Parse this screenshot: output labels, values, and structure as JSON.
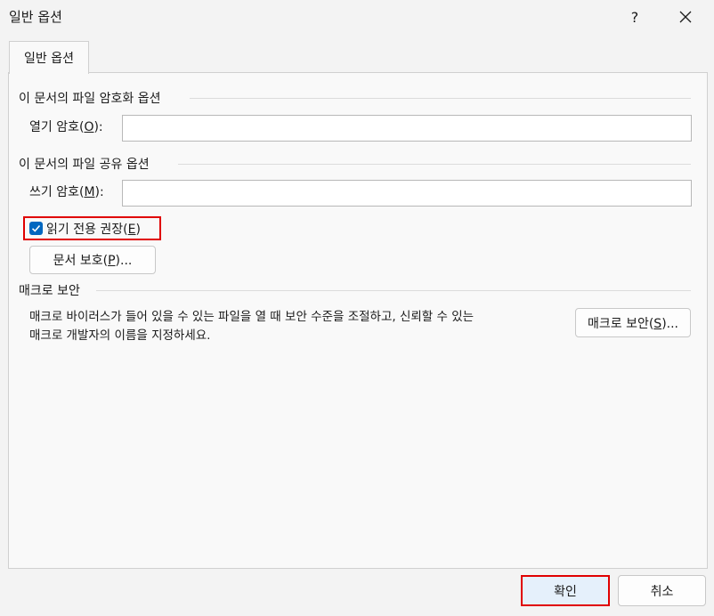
{
  "window": {
    "title": "일반 옵션",
    "help_label": "?"
  },
  "tab": {
    "label": "일반 옵션"
  },
  "encryption": {
    "section_title": "이 문서의 파일 암호화 옵션",
    "open_password_label_prefix": "열기 암호(",
    "open_password_accel": "O",
    "open_password_label_suffix": "):",
    "open_password_value": ""
  },
  "sharing": {
    "section_title": "이 문서의 파일 공유 옵션",
    "modify_password_label_prefix": "쓰기 암호(",
    "modify_password_accel": "M",
    "modify_password_label_suffix": "):",
    "modify_password_value": "",
    "read_only_checked": true,
    "read_only_label_prefix": "읽기 전용 권장(",
    "read_only_accel": "E",
    "read_only_label_suffix": ")",
    "protect_button_prefix": "문서 보호(",
    "protect_button_accel": "P",
    "protect_button_suffix": ")..."
  },
  "macro": {
    "section_title": "매크로 보안",
    "description_line1": "매크로 바이러스가 들어 있을 수 있는 파일을 열 때 보안 수준을 조절하고, 신뢰할 수 있는",
    "description_line2": "매크로 개발자의 이름을 지정하세요.",
    "button_prefix": "매크로 보안(",
    "button_accel": "S",
    "button_suffix": ")..."
  },
  "footer": {
    "ok_label": "확인",
    "cancel_label": "취소"
  },
  "colors": {
    "accent": "#0067c0",
    "highlight": "#e00000"
  }
}
